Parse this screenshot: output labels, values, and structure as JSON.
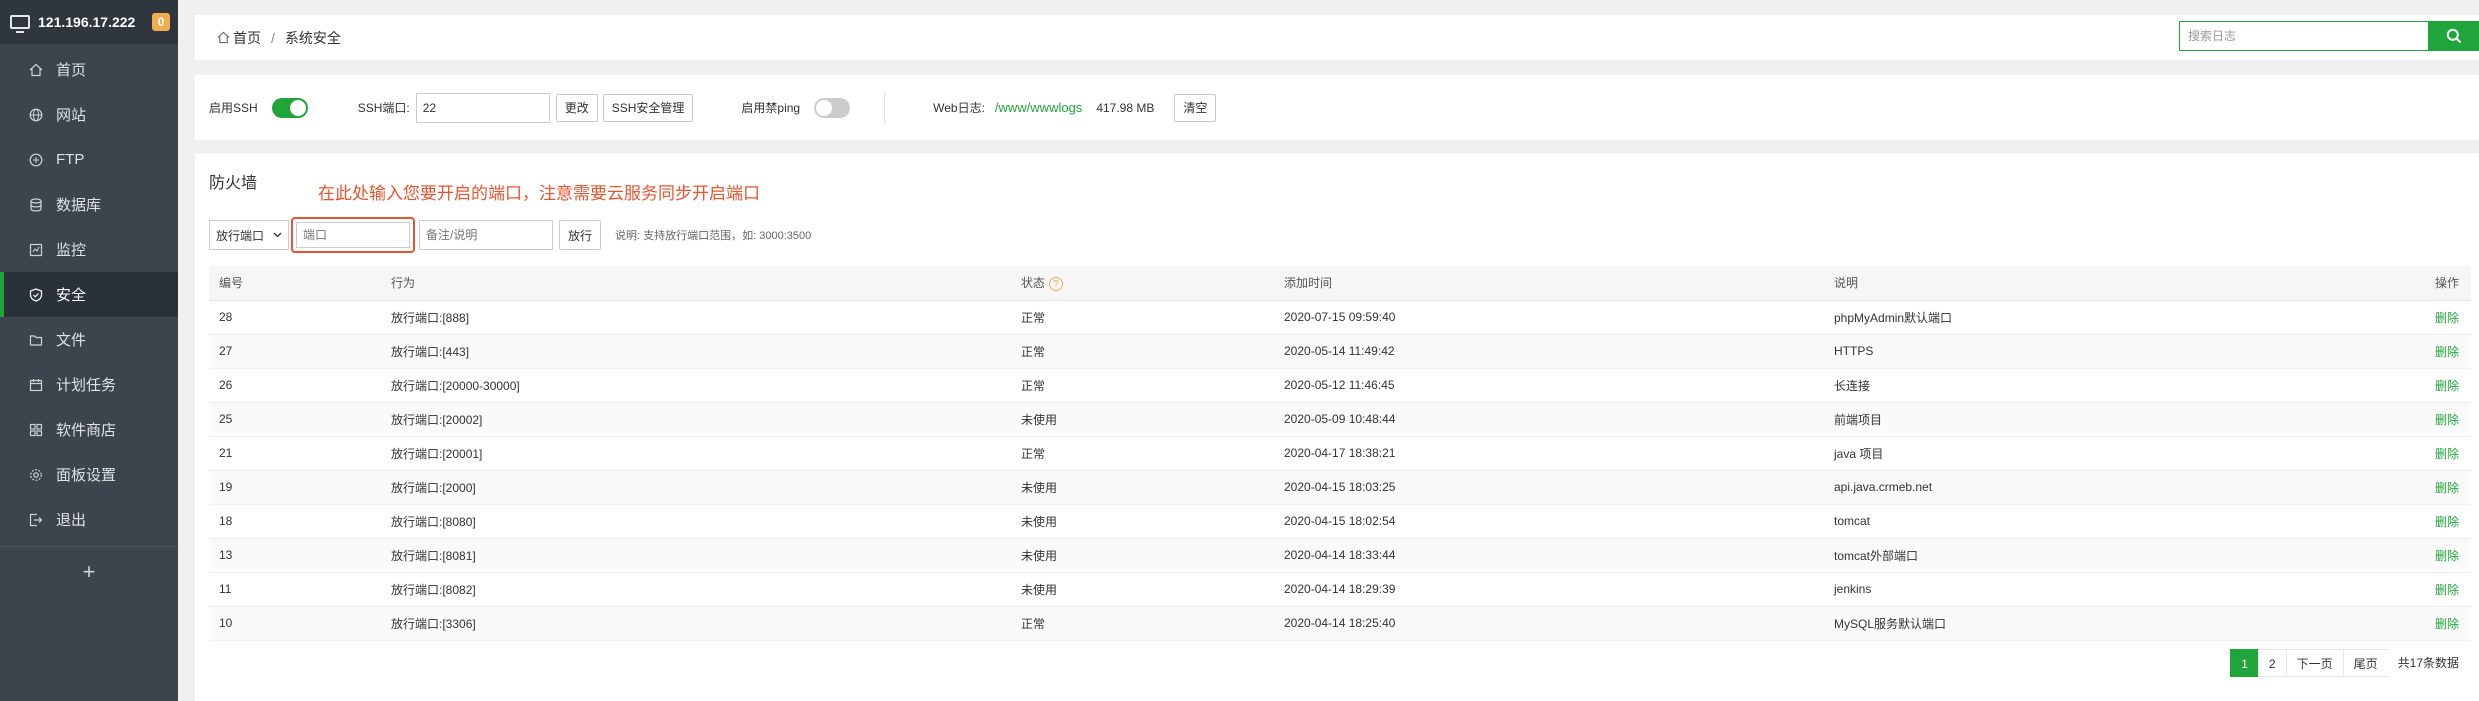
{
  "sidebar": {
    "server_ip": "121.196.17.222",
    "badge_count": "0",
    "items": [
      {
        "label": "首页",
        "icon": "home-icon"
      },
      {
        "label": "网站",
        "icon": "globe-icon"
      },
      {
        "label": "FTP",
        "icon": "ftp-icon"
      },
      {
        "label": "数据库",
        "icon": "database-icon"
      },
      {
        "label": "监控",
        "icon": "monitor-icon"
      },
      {
        "label": "安全",
        "icon": "shield-icon",
        "active": true
      },
      {
        "label": "文件",
        "icon": "folder-icon"
      },
      {
        "label": "计划任务",
        "icon": "calendar-icon"
      },
      {
        "label": "软件商店",
        "icon": "apps-icon"
      },
      {
        "label": "面板设置",
        "icon": "gear-icon"
      },
      {
        "label": "退出",
        "icon": "logout-icon"
      }
    ],
    "add_symbol": "+"
  },
  "breadcrumb": {
    "home": "首页",
    "separator": "/",
    "current": "系统安全"
  },
  "search": {
    "placeholder": "搜索日志"
  },
  "settings": {
    "ssh_enable_label": "启用SSH",
    "ssh_port_label": "SSH端口:",
    "ssh_port_value": "22",
    "change_button": "更改",
    "ssh_security_button": "SSH安全管理",
    "ping_label": "启用禁ping",
    "weblog_label": "Web日志:",
    "weblog_path": "/www/wwwlogs",
    "weblog_size": "417.98 MB",
    "clear_button": "清空"
  },
  "firewall": {
    "title": "防火墙",
    "annotation": "在此处输入您要开启的端口，注意需要云服务同步开启端口",
    "type_select": "放行端口",
    "port_placeholder": "端口",
    "remark_placeholder": "备注/说明",
    "allow_button": "放行",
    "hint": "说明: 支持放行端口范围，如: 3000:3500",
    "columns": [
      "编号",
      "行为",
      "状态",
      "添加时间",
      "说明",
      "操作"
    ],
    "rows": [
      {
        "id": "28",
        "action": "放行端口:[888]",
        "status": "正常",
        "time": "2020-07-15 09:59:40",
        "remark": "phpMyAdmin默认端口",
        "op": "删除"
      },
      {
        "id": "27",
        "action": "放行端口:[443]",
        "status": "正常",
        "time": "2020-05-14 11:49:42",
        "remark": "HTTPS",
        "op": "删除"
      },
      {
        "id": "26",
        "action": "放行端口:[20000-30000]",
        "status": "正常",
        "time": "2020-05-12 11:46:45",
        "remark": "长连接",
        "op": "删除"
      },
      {
        "id": "25",
        "action": "放行端口:[20002]",
        "status": "未使用",
        "time": "2020-05-09 10:48:44",
        "remark": "前端项目",
        "op": "删除"
      },
      {
        "id": "21",
        "action": "放行端口:[20001]",
        "status": "正常",
        "time": "2020-04-17 18:38:21",
        "remark": "java 项目",
        "op": "删除"
      },
      {
        "id": "19",
        "action": "放行端口:[2000]",
        "status": "未使用",
        "time": "2020-04-15 18:03:25",
        "remark": "api.java.crmeb.net",
        "op": "删除"
      },
      {
        "id": "18",
        "action": "放行端口:[8080]",
        "status": "未使用",
        "time": "2020-04-15 18:02:54",
        "remark": "tomcat",
        "op": "删除"
      },
      {
        "id": "13",
        "action": "放行端口:[8081]",
        "status": "未使用",
        "time": "2020-04-14 18:33:44",
        "remark": "tomcat外部端口",
        "op": "删除"
      },
      {
        "id": "11",
        "action": "放行端口:[8082]",
        "status": "未使用",
        "time": "2020-04-14 18:29:39",
        "remark": "jenkins",
        "op": "删除"
      },
      {
        "id": "10",
        "action": "放行端口:[3306]",
        "status": "正常",
        "time": "2020-04-14 18:25:40",
        "remark": "MySQL服务默认端口",
        "op": "删除"
      }
    ]
  },
  "pagination": {
    "current": "1",
    "page2": "2",
    "next": "下一页",
    "last": "尾页",
    "total": "共17条数据"
  },
  "colors": {
    "accent": "#20a53a",
    "sidebar_bg": "#3c444d",
    "annotation": "#e8542f",
    "badge": "#f0ad4e"
  }
}
